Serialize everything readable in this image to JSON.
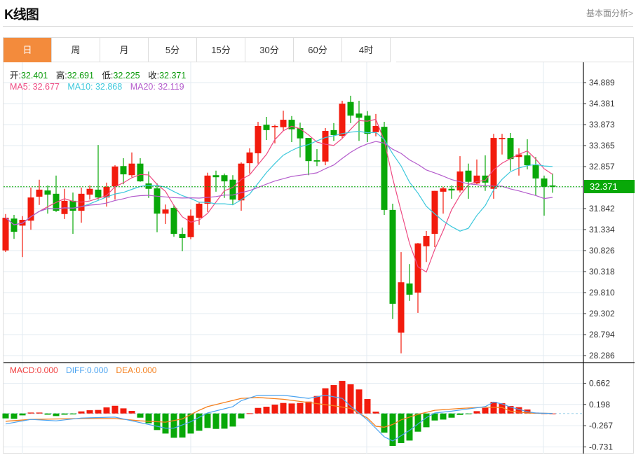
{
  "header": {
    "title": "K线图",
    "fundamental_link": "基本面分析>"
  },
  "tabs": [
    {
      "label": "日",
      "active": true
    },
    {
      "label": "周",
      "active": false
    },
    {
      "label": "月",
      "active": false
    },
    {
      "label": "5分",
      "active": false
    },
    {
      "label": "15分",
      "active": false
    },
    {
      "label": "30分",
      "active": false
    },
    {
      "label": "60分",
      "active": false
    },
    {
      "label": "4时",
      "active": false
    }
  ],
  "quote": {
    "open_label": "开:",
    "open": "32.401",
    "high_label": "高:",
    "high": "32.691",
    "low_label": "低:",
    "low": "32.225",
    "close_label": "收:",
    "close": "32.371"
  },
  "ma": {
    "ma5": "MA5: 32.677",
    "ma10": "MA10: 32.868",
    "ma20": "MA20: 32.119"
  },
  "macd_legend": {
    "macd": "MACD:0.000",
    "diff": "DIFF:0.000",
    "dea": "DEA:0.000"
  },
  "colors": {
    "up": "#f21b0d",
    "down": "#08a808",
    "ma5": "#ee4a82",
    "ma10": "#3cc8dc",
    "ma20": "#b45ccc",
    "macd": "#f04040",
    "diff": "#4aa3f0",
    "dea": "#f5801e",
    "accent": "#f38b3c"
  },
  "chart_data": [
    {
      "type": "candlestick",
      "title": "K线图 (日)",
      "ylim": [
        28.286,
        34.889
      ],
      "y_ticks": [
        "34.889",
        "34.381",
        "33.873",
        "33.365",
        "32.857",
        "31.842",
        "31.334",
        "30.826",
        "30.318",
        "29.810",
        "29.302",
        "28.794",
        "28.286"
      ],
      "y_tick_values": [
        34.889,
        34.381,
        33.873,
        33.365,
        32.857,
        31.842,
        31.334,
        30.826,
        30.318,
        29.81,
        29.302,
        28.794,
        28.286
      ],
      "current_price": "32.371",
      "ohlc_fields": [
        "open",
        "high",
        "low",
        "close"
      ],
      "ohlc": [
        [
          30.83,
          31.71,
          30.79,
          31.62
        ],
        [
          31.6,
          31.69,
          31.11,
          31.28
        ],
        [
          31.43,
          31.66,
          30.67,
          31.57
        ],
        [
          31.55,
          32.35,
          31.33,
          32.11
        ],
        [
          32.13,
          32.54,
          31.93,
          32.3
        ],
        [
          32.28,
          32.4,
          31.72,
          32.18
        ],
        [
          32.2,
          32.64,
          31.76,
          31.79
        ],
        [
          31.71,
          32.32,
          31.59,
          32.03
        ],
        [
          32.03,
          32.23,
          31.23,
          31.79
        ],
        [
          31.79,
          32.35,
          31.5,
          32.2
        ],
        [
          32.18,
          32.4,
          32.06,
          32.32
        ],
        [
          32.3,
          33.38,
          32.06,
          32.11
        ],
        [
          32.11,
          32.47,
          31.89,
          32.37
        ],
        [
          32.38,
          32.89,
          32.06,
          32.86
        ],
        [
          32.87,
          33.06,
          32.43,
          32.67
        ],
        [
          32.65,
          33.2,
          32.6,
          32.93
        ],
        [
          32.93,
          33.06,
          32.49,
          32.5
        ],
        [
          32.45,
          32.74,
          32.1,
          32.32
        ],
        [
          32.33,
          32.45,
          31.27,
          31.72
        ],
        [
          31.72,
          31.94,
          31.47,
          31.82
        ],
        [
          31.86,
          31.93,
          31.16,
          31.23
        ],
        [
          31.23,
          31.38,
          30.81,
          31.13
        ],
        [
          31.15,
          31.82,
          31.1,
          31.67
        ],
        [
          31.62,
          31.99,
          31.45,
          31.96
        ],
        [
          31.96,
          32.71,
          31.76,
          32.64
        ],
        [
          32.65,
          32.76,
          32.25,
          32.6
        ],
        [
          32.65,
          32.69,
          32.1,
          32.5
        ],
        [
          32.54,
          32.65,
          31.93,
          32.06
        ],
        [
          32.04,
          32.96,
          31.79,
          32.93
        ],
        [
          32.94,
          33.3,
          32.69,
          33.2
        ],
        [
          33.18,
          33.94,
          32.93,
          33.84
        ],
        [
          33.87,
          34.06,
          33.5,
          33.74
        ],
        [
          33.81,
          33.87,
          33.42,
          33.84
        ],
        [
          33.81,
          34.21,
          33.72,
          33.99
        ],
        [
          33.99,
          34.08,
          33.45,
          33.76
        ],
        [
          33.79,
          33.92,
          33.08,
          33.54
        ],
        [
          33.55,
          33.55,
          32.65,
          32.99
        ],
        [
          33.01,
          33.28,
          32.87,
          32.98
        ],
        [
          32.98,
          33.79,
          32.89,
          33.72
        ],
        [
          33.74,
          33.91,
          33.48,
          33.62
        ],
        [
          33.6,
          34.45,
          33.55,
          34.38
        ],
        [
          34.42,
          34.57,
          33.91,
          34.09
        ],
        [
          34.14,
          34.45,
          33.48,
          34.04
        ],
        [
          34.09,
          34.2,
          33.45,
          33.65
        ],
        [
          33.69,
          34.13,
          33.59,
          33.84
        ],
        [
          33.82,
          33.94,
          31.69,
          31.81
        ],
        [
          31.81,
          31.96,
          29.17,
          29.54
        ],
        [
          28.84,
          30.79,
          28.34,
          30.06
        ],
        [
          30.03,
          30.5,
          29.61,
          29.76
        ],
        [
          29.81,
          31.01,
          29.32,
          31.0
        ],
        [
          30.93,
          31.3,
          30.55,
          31.18
        ],
        [
          31.23,
          32.27,
          30.91,
          32.27
        ],
        [
          32.25,
          32.37,
          31.72,
          32.33
        ],
        [
          32.32,
          32.4,
          32.08,
          32.28
        ],
        [
          32.28,
          33.11,
          32.23,
          32.74
        ],
        [
          32.76,
          32.93,
          32.08,
          32.49
        ],
        [
          32.45,
          33.03,
          32.43,
          32.64
        ],
        [
          32.64,
          33.13,
          32.27,
          32.47
        ],
        [
          32.32,
          33.65,
          32.08,
          33.55
        ],
        [
          33.52,
          33.65,
          33.15,
          33.55
        ],
        [
          33.55,
          33.67,
          32.76,
          33.04
        ],
        [
          33.09,
          33.3,
          32.64,
          33.15
        ],
        [
          33.13,
          33.52,
          32.79,
          32.89
        ],
        [
          32.89,
          33.09,
          32.16,
          32.57
        ],
        [
          32.57,
          32.64,
          31.67,
          32.37
        ],
        [
          32.401,
          32.691,
          32.225,
          32.371
        ]
      ],
      "ma_periods": [
        5,
        10,
        20
      ]
    },
    {
      "type": "bar",
      "title": "MACD",
      "ylim": [
        -0.731,
        0.662
      ],
      "y_ticks": [
        "0.662",
        "0.198",
        "-0.267",
        "-0.731"
      ],
      "y_tick_values": [
        0.662,
        0.198,
        -0.267,
        -0.731
      ],
      "histogram": [
        -0.107,
        -0.117,
        -0.041,
        0.02,
        0.02,
        -0.026,
        -0.056,
        -0.026,
        -0.02,
        0.046,
        0.071,
        0.077,
        0.133,
        0.168,
        0.112,
        0.056,
        -0.092,
        -0.214,
        -0.362,
        -0.439,
        -0.531,
        -0.526,
        -0.439,
        -0.378,
        -0.316,
        -0.337,
        -0.332,
        -0.286,
        -0.107,
        0.005,
        0.122,
        0.148,
        0.194,
        0.23,
        0.219,
        0.23,
        0.26,
        0.383,
        0.551,
        0.622,
        0.714,
        0.638,
        0.526,
        0.316,
        0.041,
        -0.418,
        -0.709,
        -0.648,
        -0.592,
        -0.398,
        -0.301,
        -0.153,
        -0.133,
        -0.092,
        -0.031,
        -0.015,
        0.051,
        0.122,
        0.255,
        0.224,
        0.163,
        0.138,
        0.087,
        0.02,
        0.005,
        0
      ],
      "diff_points": [
        [
          1,
          -0.23
        ],
        [
          4,
          -0.13
        ],
        [
          7,
          -0.16
        ],
        [
          10,
          -0.1
        ],
        [
          14,
          -0.08
        ],
        [
          17,
          -0.2
        ],
        [
          20,
          -0.32
        ],
        [
          21,
          -0.32
        ],
        [
          23,
          -0.18
        ],
        [
          25,
          0.01
        ],
        [
          28,
          0.15
        ],
        [
          29,
          0.28
        ],
        [
          31,
          0.4
        ],
        [
          34,
          0.4
        ],
        [
          37,
          0.33
        ],
        [
          39,
          0.4
        ],
        [
          41,
          0.33
        ],
        [
          42,
          0.16
        ],
        [
          44,
          -0.14
        ],
        [
          46,
          -0.51
        ],
        [
          47,
          -0.6
        ],
        [
          49,
          -0.37
        ],
        [
          51,
          -0.09
        ],
        [
          52,
          0.01
        ],
        [
          54,
          0.05
        ],
        [
          56,
          0.1
        ],
        [
          58,
          0.15
        ],
        [
          59,
          0.25
        ],
        [
          60,
          0.21
        ],
        [
          61,
          0.14
        ],
        [
          62,
          0.09
        ],
        [
          63,
          0.04
        ],
        [
          64,
          0.01
        ],
        [
          66,
          0
        ]
      ],
      "dea_points": [
        [
          1,
          -0.17
        ],
        [
          4,
          -0.13
        ],
        [
          10,
          -0.11
        ],
        [
          14,
          -0.11
        ],
        [
          17,
          -0.16
        ],
        [
          20,
          -0.19
        ],
        [
          22,
          -0.12
        ],
        [
          24,
          0.07
        ],
        [
          25,
          0.15
        ],
        [
          29,
          0.33
        ],
        [
          31,
          0.35
        ],
        [
          34,
          0.31
        ],
        [
          37,
          0.24
        ],
        [
          40,
          0.17
        ],
        [
          42,
          0.11
        ],
        [
          44,
          -0.1
        ],
        [
          45,
          -0.28
        ],
        [
          46,
          -0.3
        ],
        [
          47,
          -0.24
        ],
        [
          48,
          -0.14
        ],
        [
          50,
          -0.02
        ],
        [
          52,
          0.07
        ],
        [
          55,
          0.11
        ],
        [
          58,
          0.14
        ],
        [
          60,
          0.13
        ],
        [
          61,
          0.05
        ],
        [
          63,
          0.01
        ],
        [
          66,
          0
        ]
      ]
    }
  ]
}
